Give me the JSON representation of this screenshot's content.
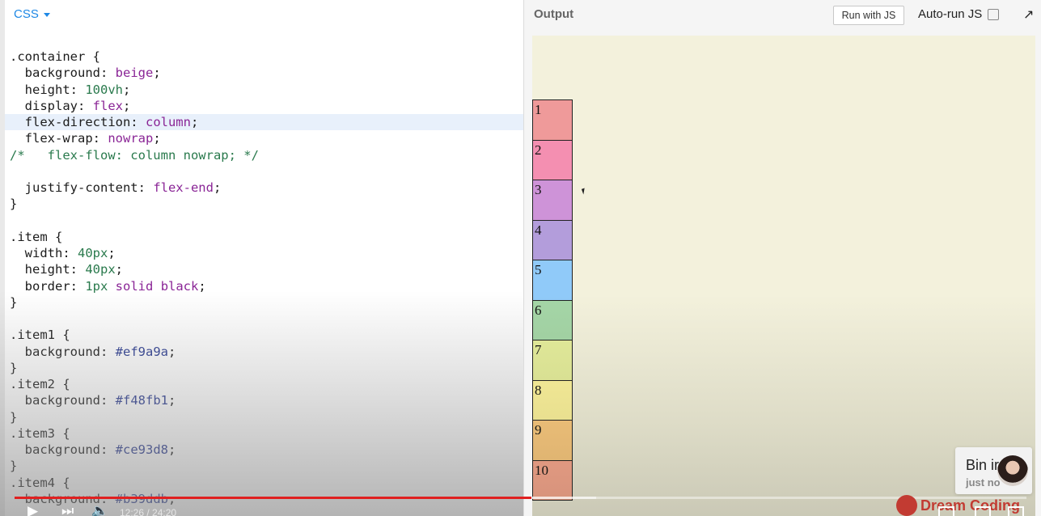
{
  "css_pane": {
    "tab_label": "CSS",
    "code_lines": [
      {
        "parts": [
          {
            "c": "sel",
            "t": ".container {"
          }
        ]
      },
      {
        "parts": [
          {
            "c": "prop",
            "t": "  background: "
          },
          {
            "c": "kw",
            "t": "beige"
          },
          {
            "c": "punc",
            "t": ";"
          }
        ]
      },
      {
        "parts": [
          {
            "c": "prop",
            "t": "  height: "
          },
          {
            "c": "num",
            "t": "100vh"
          },
          {
            "c": "punc",
            "t": ";"
          }
        ]
      },
      {
        "parts": [
          {
            "c": "prop",
            "t": "  display: "
          },
          {
            "c": "kw",
            "t": "flex"
          },
          {
            "c": "punc",
            "t": ";"
          }
        ]
      },
      {
        "active": true,
        "parts": [
          {
            "c": "prop",
            "t": "  flex-direction: "
          },
          {
            "c": "kw",
            "t": "column"
          },
          {
            "c": "punc",
            "t": ";"
          }
        ]
      },
      {
        "parts": [
          {
            "c": "prop",
            "t": "  flex-wrap: "
          },
          {
            "c": "kw",
            "t": "nowrap"
          },
          {
            "c": "punc",
            "t": ";"
          }
        ]
      },
      {
        "parts": [
          {
            "c": "cmt",
            "t": "/*   flex-flow: column nowrap; */"
          }
        ]
      },
      {
        "parts": [
          {
            "c": "punc",
            "t": ""
          }
        ]
      },
      {
        "parts": [
          {
            "c": "prop",
            "t": "  justify-content: "
          },
          {
            "c": "kw",
            "t": "flex-end"
          },
          {
            "c": "punc",
            "t": ";"
          }
        ]
      },
      {
        "parts": [
          {
            "c": "punc",
            "t": "}"
          }
        ]
      },
      {
        "parts": [
          {
            "c": "punc",
            "t": ""
          }
        ]
      },
      {
        "parts": [
          {
            "c": "sel",
            "t": ".item {"
          }
        ]
      },
      {
        "parts": [
          {
            "c": "prop",
            "t": "  width: "
          },
          {
            "c": "num",
            "t": "40px"
          },
          {
            "c": "punc",
            "t": ";"
          }
        ]
      },
      {
        "parts": [
          {
            "c": "prop",
            "t": "  height: "
          },
          {
            "c": "num",
            "t": "40px"
          },
          {
            "c": "punc",
            "t": ";"
          }
        ]
      },
      {
        "parts": [
          {
            "c": "prop",
            "t": "  border: "
          },
          {
            "c": "num",
            "t": "1px"
          },
          {
            "c": "punc",
            "t": " "
          },
          {
            "c": "kw",
            "t": "solid"
          },
          {
            "c": "punc",
            "t": " "
          },
          {
            "c": "kw",
            "t": "black"
          },
          {
            "c": "punc",
            "t": ";"
          }
        ]
      },
      {
        "parts": [
          {
            "c": "punc",
            "t": "}"
          }
        ]
      },
      {
        "parts": [
          {
            "c": "punc",
            "t": ""
          }
        ]
      },
      {
        "parts": [
          {
            "c": "sel",
            "t": ".item1 {"
          }
        ]
      },
      {
        "parts": [
          {
            "c": "prop",
            "t": "  background: "
          },
          {
            "c": "hex",
            "t": "#ef9a9a"
          },
          {
            "c": "punc",
            "t": ";"
          }
        ]
      },
      {
        "parts": [
          {
            "c": "punc",
            "t": "}"
          }
        ]
      },
      {
        "parts": [
          {
            "c": "sel",
            "t": ".item2 {"
          }
        ]
      },
      {
        "parts": [
          {
            "c": "prop",
            "t": "  background: "
          },
          {
            "c": "hex",
            "t": "#f48fb1"
          },
          {
            "c": "punc",
            "t": ";"
          }
        ]
      },
      {
        "parts": [
          {
            "c": "punc",
            "t": "}"
          }
        ]
      },
      {
        "parts": [
          {
            "c": "sel",
            "t": ".item3 {"
          }
        ]
      },
      {
        "parts": [
          {
            "c": "prop",
            "t": "  background: "
          },
          {
            "c": "hex",
            "t": "#ce93d8"
          },
          {
            "c": "punc",
            "t": ";"
          }
        ]
      },
      {
        "parts": [
          {
            "c": "punc",
            "t": "}"
          }
        ]
      },
      {
        "parts": [
          {
            "c": "sel",
            "t": ".item4 {"
          }
        ]
      },
      {
        "parts": [
          {
            "c": "prop",
            "t": "  background: "
          },
          {
            "c": "hex",
            "t": "#b39ddb"
          },
          {
            "c": "punc",
            "t": ";"
          }
        ]
      }
    ]
  },
  "output_pane": {
    "title": "Output",
    "run_button_label": "Run with JS",
    "autorun_label": "Auto-run JS",
    "items": [
      {
        "label": "1",
        "color": "#ef9a9a"
      },
      {
        "label": "2",
        "color": "#f48fb1"
      },
      {
        "label": "3",
        "color": "#ce93d8"
      },
      {
        "label": "4",
        "color": "#b39ddb"
      },
      {
        "label": "5",
        "color": "#90caf9"
      },
      {
        "label": "6",
        "color": "#a5d6a7"
      },
      {
        "label": "7",
        "color": "#e6ee9c"
      },
      {
        "label": "8",
        "color": "#fff59d"
      },
      {
        "label": "9",
        "color": "#ffcc80"
      },
      {
        "label": "10",
        "color": "#ffab91"
      }
    ]
  },
  "channel_card": {
    "name": "Bin ir",
    "sub": "just no"
  },
  "video": {
    "time": "12:26 / 24:20",
    "progress": 0.511,
    "buffered": 0.575,
    "watermark": "Dream Coding"
  }
}
